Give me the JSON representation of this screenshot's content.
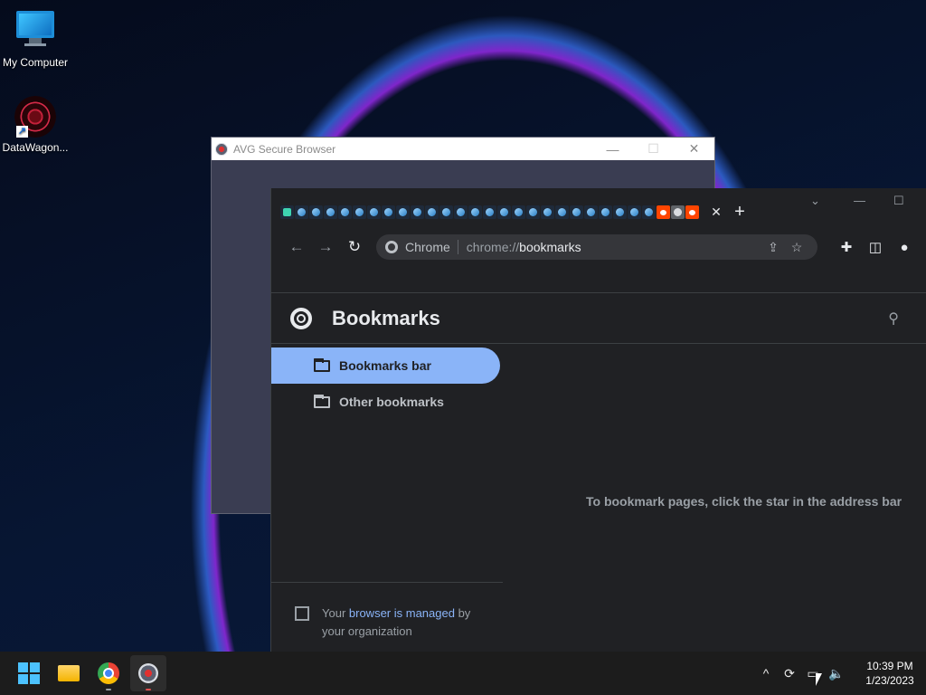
{
  "desktop": {
    "icons": [
      {
        "label": "My Computer"
      },
      {
        "label": "DataWagon..."
      }
    ]
  },
  "avg_window": {
    "title": "AVG Secure Browser",
    "controls": {
      "minimize": "—",
      "maximize": "☐",
      "close": "✕"
    }
  },
  "chrome": {
    "tab_close": "✕",
    "new_tab": "+",
    "window_controls": {
      "dropdown": "⌄",
      "minimize": "—",
      "maximize": "☐"
    },
    "toolbar": {
      "back": "←",
      "forward": "→",
      "reload": "↻",
      "chip_label": "Chrome",
      "url_scheme": "chrome://",
      "url_host": "bookmarks",
      "share_icon": "⇪",
      "star_icon": "☆",
      "extensions_icon": "✚",
      "sidepanel_icon": "◫",
      "profile_icon": "●"
    },
    "page": {
      "title": "Bookmarks",
      "search_icon": "⚲",
      "sidebar": [
        {
          "label": "Bookmarks bar",
          "active": true
        },
        {
          "label": "Other bookmarks",
          "active": false
        }
      ],
      "empty_message": "To bookmark pages, click the star in the address bar",
      "managed": {
        "prefix": "Your ",
        "link": "browser is managed",
        "suffix": " by your organization"
      }
    }
  },
  "taskbar": {
    "tray": {
      "chevron": "^",
      "sync": "⟳",
      "network": "▭",
      "volume": "🔈",
      "time": "10:39 PM",
      "date": "1/23/2023"
    }
  },
  "colors": {
    "accent": "#8ab4f8",
    "chrome_bg": "#202124",
    "taskbar_bg": "#1c1c1c"
  }
}
